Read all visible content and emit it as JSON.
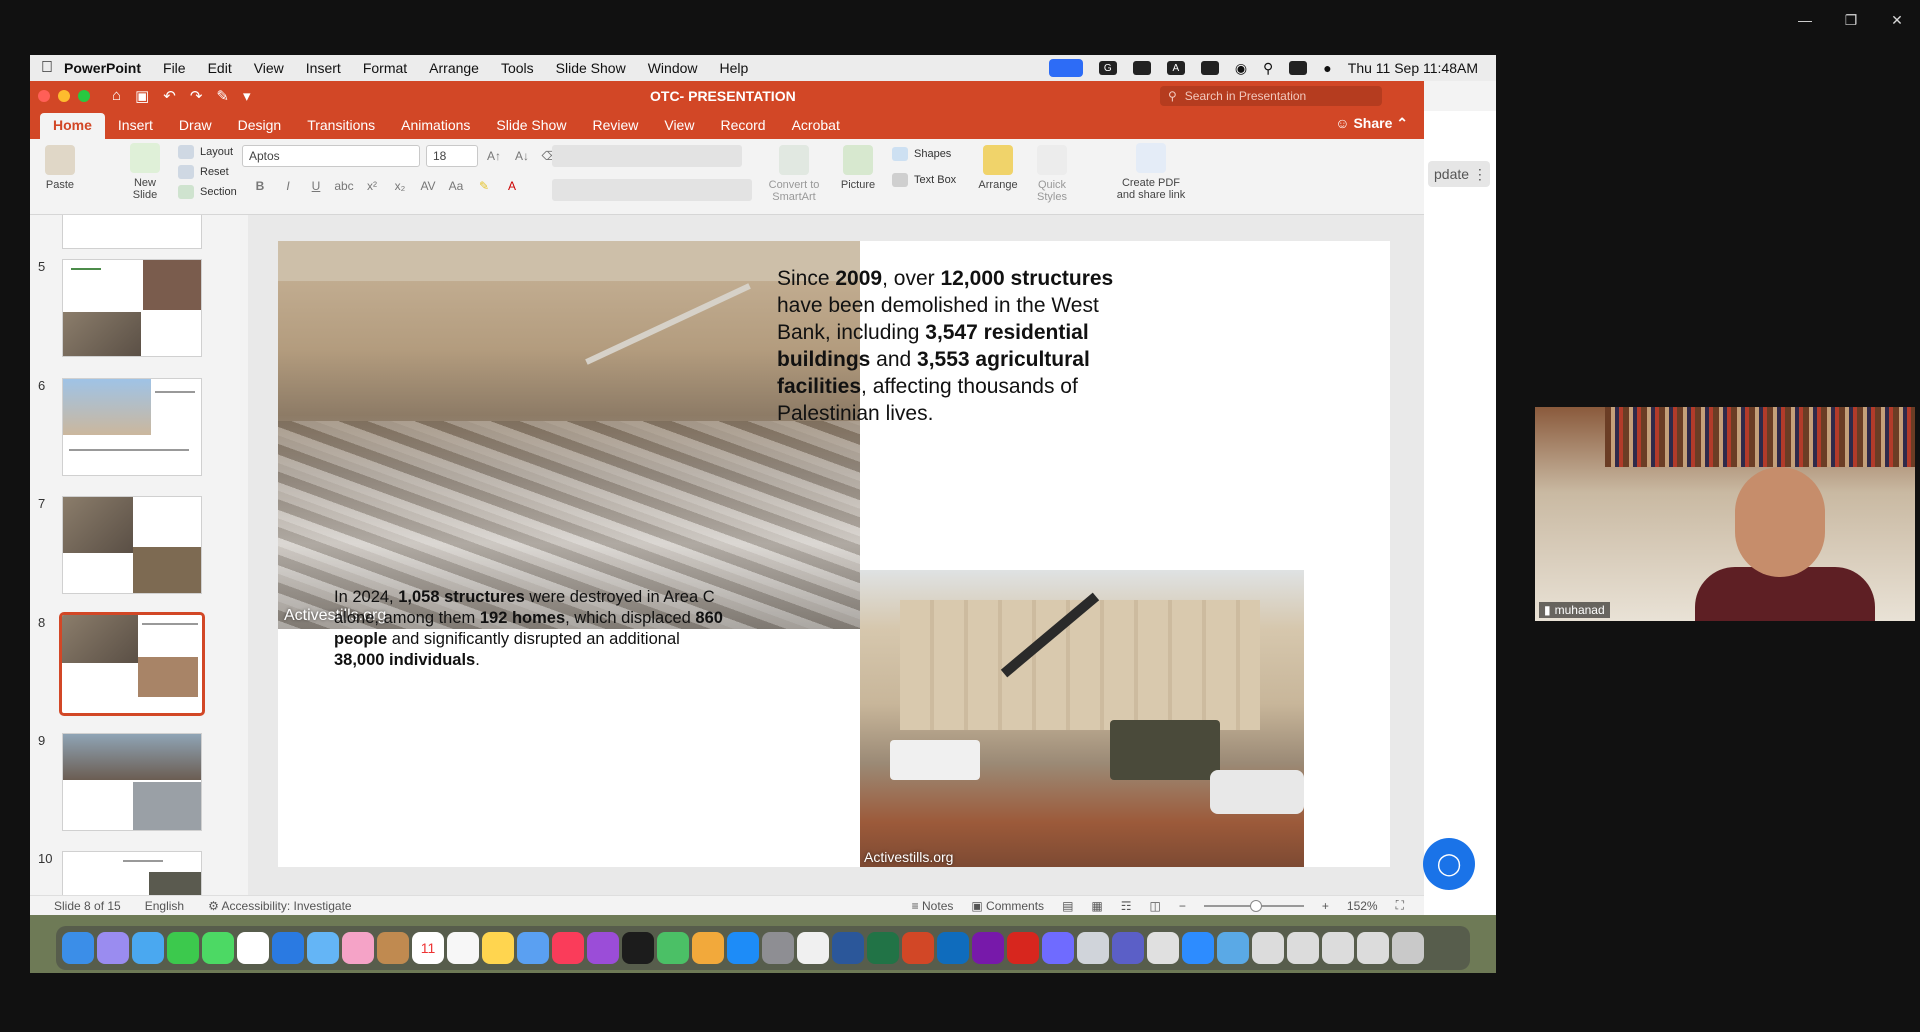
{
  "menubar": {
    "app": "PowerPoint",
    "items": [
      "File",
      "Edit",
      "View",
      "Insert",
      "Format",
      "Arrange",
      "Tools",
      "Slide Show",
      "Window",
      "Help"
    ],
    "clock": "Thu 11 Sep  11:48AM"
  },
  "ppt": {
    "doc_title": "OTC- PRESENTATION",
    "search_placeholder": "Search in Presentation",
    "tabs": [
      "Home",
      "Insert",
      "Draw",
      "Design",
      "Transitions",
      "Animations",
      "Slide Show",
      "Review",
      "View",
      "Record",
      "Acrobat"
    ],
    "share": "Share",
    "update": "pdate"
  },
  "ribbon": {
    "paste": "Paste",
    "new_slide": "New Slide",
    "layout": "Layout",
    "reset": "Reset",
    "section": "Section",
    "font_name": "Aptos",
    "font_size": "18",
    "convert": "Convert to SmartArt",
    "picture": "Picture",
    "shapes": "Shapes",
    "text_box": "Text Box",
    "arrange": "Arrange",
    "quick_styles": "Quick Styles",
    "create_pdf": "Create PDF and share link"
  },
  "thumbnails": [
    {
      "num": "5"
    },
    {
      "num": "6"
    },
    {
      "num": "7"
    },
    {
      "num": "8",
      "selected": true
    },
    {
      "num": "9"
    },
    {
      "num": "10"
    }
  ],
  "slide": {
    "watermark1": "Activestills.org",
    "watermark2": "Activestills.org",
    "text1": {
      "t1": "Since ",
      "b1": "2009",
      "t2": ", over ",
      "b2": "12,000 structures",
      "t3": " have been demolished in the West Bank, including ",
      "b3": "3,547 residential buildings",
      "t4": " and ",
      "b4": "3,553 agricultural facilities",
      "t5": ", affecting thousands of Palestinian lives."
    },
    "text2": {
      "t1": "In 2024, ",
      "b1": "1,058 structures",
      "t2": " were destroyed in Area C alone, among them ",
      "b2": "192 homes",
      "t3": ", which displaced ",
      "b3": "860 people",
      "t4": " and significantly disrupted an additional ",
      "b4": "38,000 individuals",
      "t5": "."
    }
  },
  "status": {
    "slide_counter": "Slide 8 of 15",
    "language": "English",
    "accessibility": "Accessibility: Investigate",
    "notes": "Notes",
    "comments": "Comments",
    "zoom": "152%",
    "zoom_level": 0.52
  },
  "video": {
    "participant": "muhanad"
  },
  "colors": {
    "ppt_accent": "#d24726",
    "help_bubble": "#1a73e8"
  }
}
